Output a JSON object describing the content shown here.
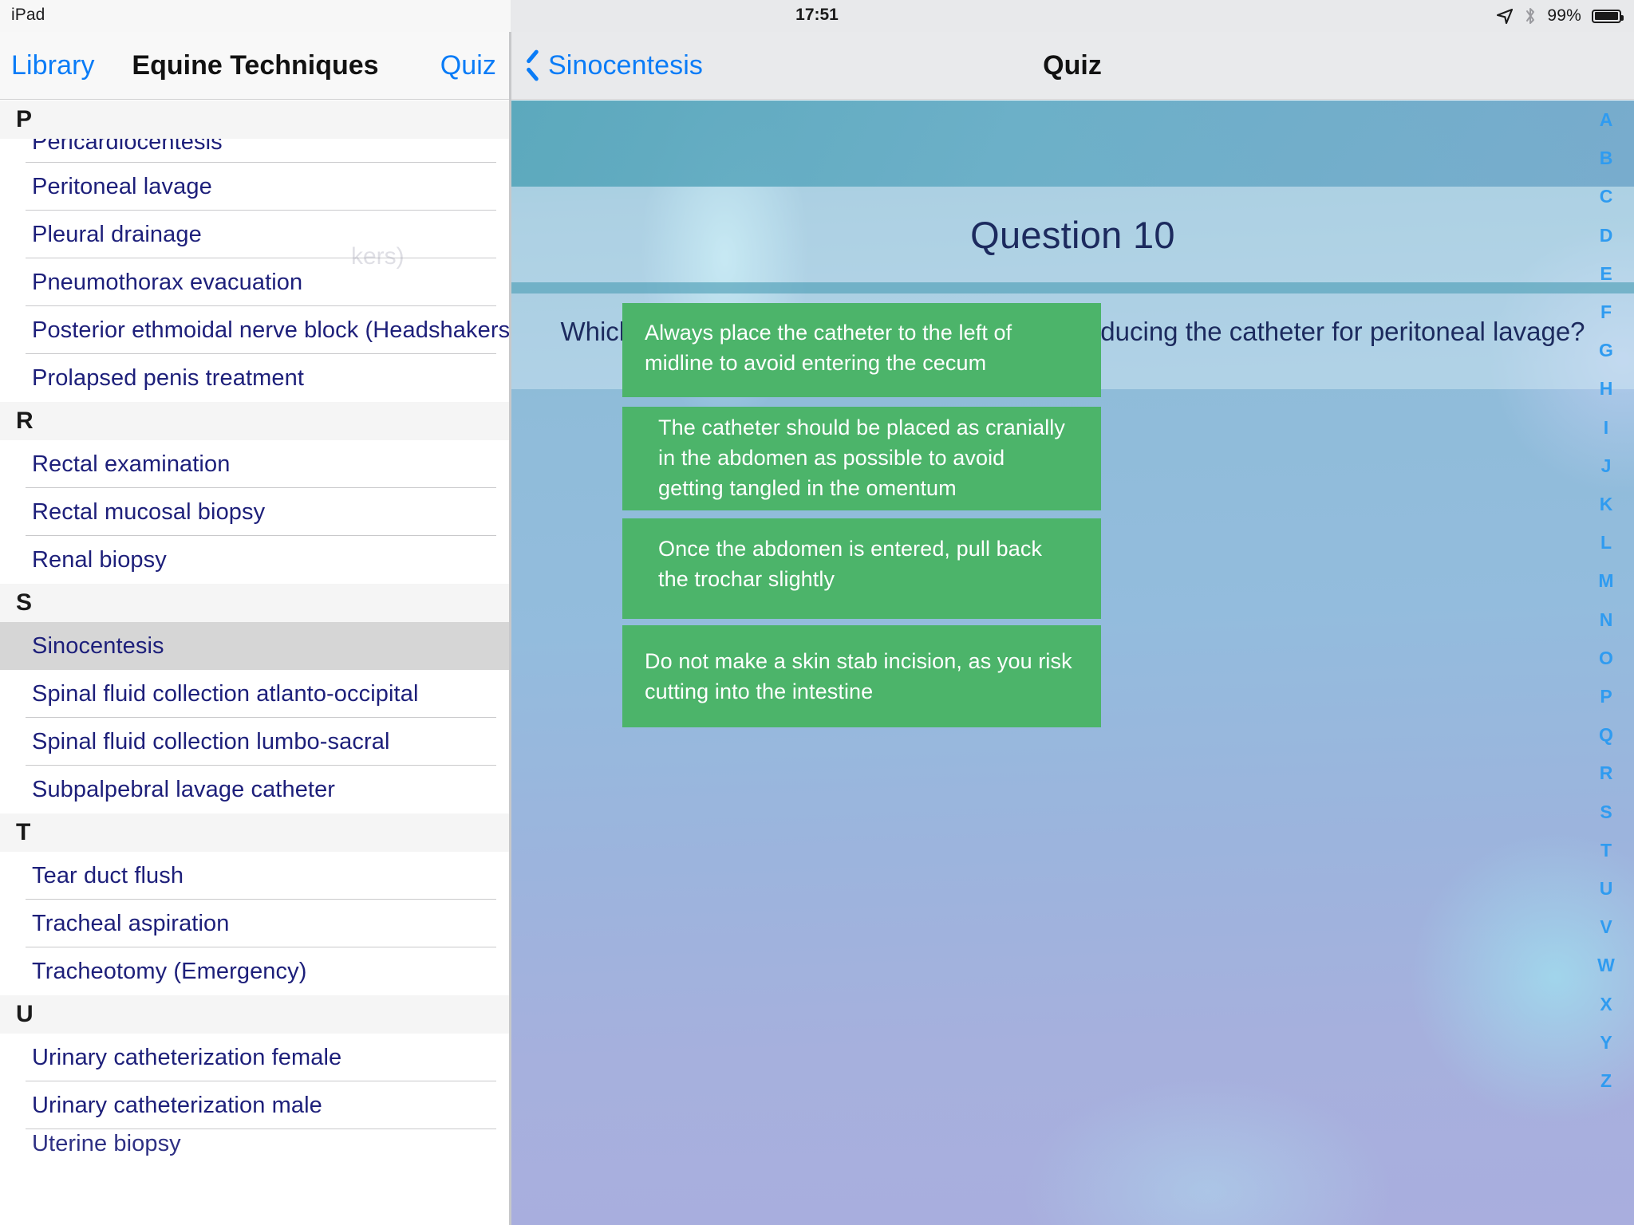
{
  "status_bar": {
    "device": "iPad",
    "time": "17:51",
    "battery_percent": "99%",
    "location_icon": "location-arrow-icon",
    "bluetooth_icon": "bluetooth-icon",
    "battery_icon": "battery-full-icon"
  },
  "left_pane": {
    "back_label": "Library",
    "title": "Equine Techniques",
    "action_label": "Quiz",
    "index_letters": [
      "A",
      "B",
      "C",
      "D",
      "E",
      "F",
      "G",
      "H",
      "I",
      "J",
      "K",
      "L",
      "M",
      "N",
      "O",
      "P",
      "Q",
      "R",
      "S",
      "T",
      "U",
      "V",
      "W",
      "X",
      "Y",
      "Z"
    ],
    "sections": [
      {
        "letter": "P",
        "items": [
          "Pericardiocentesis",
          "Peritoneal lavage",
          "Pleural drainage",
          "Pneumothorax evacuation",
          "Posterior ethmoidal nerve block (Headshakers)",
          "Prolapsed penis treatment"
        ]
      },
      {
        "letter": "R",
        "items": [
          "Rectal examination",
          "Rectal mucosal biopsy",
          "Renal biopsy"
        ]
      },
      {
        "letter": "S",
        "items": [
          "Sinocentesis",
          "Spinal fluid collection atlanto-occipital",
          "Spinal fluid collection lumbo-sacral",
          "Subpalpebral lavage catheter"
        ]
      },
      {
        "letter": "T",
        "items": [
          "Tear duct flush",
          "Tracheal aspiration",
          "Tracheotomy (Emergency)"
        ]
      },
      {
        "letter": "U",
        "items": [
          "Urinary catheterization female",
          "Urinary catheterization male",
          "Uterine biopsy"
        ]
      }
    ],
    "selected_item": "Sinocentesis"
  },
  "right_pane": {
    "back_label": "Sinocentesis",
    "back_icon": "chevron-left-icon",
    "title": "Quiz"
  },
  "quiz": {
    "question_number_label": "Question 10",
    "question_text": "Which of these is an important step when introducing the catheter for peritoneal lavage?",
    "answers": [
      "Always place the catheter to the left of midline to avoid entering the cecum",
      "The catheter should be placed as cranially in the abdomen as possible to avoid getting tangled in the omentum",
      "Once the abdomen is entered, pull back the trochar slightly",
      "Do not make a skin stab incision, as you risk cutting into the intestine"
    ],
    "answer_color": "#4cb46a",
    "answer_text_color": "#ffffff"
  },
  "colors": {
    "accent_blue": "#0a7cf7",
    "index_blue": "#2f9bf0",
    "list_text": "#1d1f7a",
    "selected_row": "#d6d6d6",
    "question_text": "#1c2a5e"
  }
}
